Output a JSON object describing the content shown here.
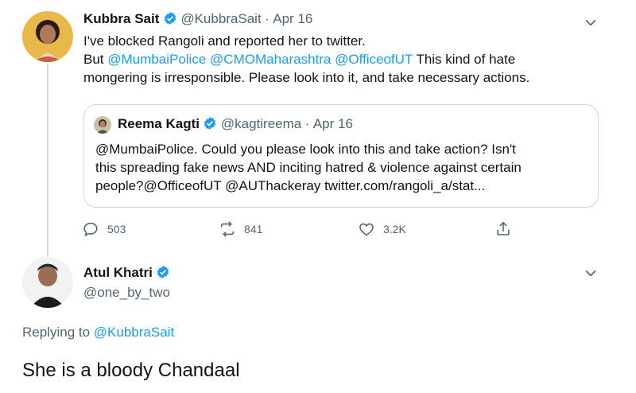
{
  "tweet1": {
    "name": "Kubbra Sait",
    "handle": "@KubbraSait",
    "sep": "·",
    "date": "Apr 16",
    "line1": "I've blocked Rangoli and reported her to twitter.",
    "line2_prefix": "But",
    "mention1": "@MumbaiPolice",
    "mention2": "@CMOMaharashtra",
    "mention3": "@OfficeofUT",
    "line2_suffix": "This kind of hate",
    "line3": "mongering is irresponsible. Please look into it, and take necessary actions.",
    "quote": {
      "name": "Reema Kagti",
      "handle": "@kagtireema",
      "sep": "·",
      "date": "Apr 16",
      "line1": "@MumbaiPolice. Could you please look into this and take action? Isn't",
      "line2": "this spreading fake news AND inciting hatred & violence against certain",
      "line3": "people?@OfficeofUT @AUThackeray twitter.com/rangoli_a/stat..."
    },
    "actions": {
      "replies": "503",
      "retweets": "841",
      "likes": "3.2K"
    }
  },
  "tweet2": {
    "name": "Atul Khatri",
    "handle": "@one_by_two",
    "replying_prefix": "Replying to",
    "replying_to": "@KubbraSait",
    "body": "She is a bloody Chandaal"
  },
  "icons": {
    "verified": "verified-badge-icon",
    "reply": "reply-icon",
    "retweet": "retweet-icon",
    "like": "heart-icon",
    "share": "share-icon",
    "more": "chevron-down-icon"
  },
  "colors": {
    "link": "#1d9bf0",
    "muted": "#536471",
    "border": "#cfd9de"
  }
}
